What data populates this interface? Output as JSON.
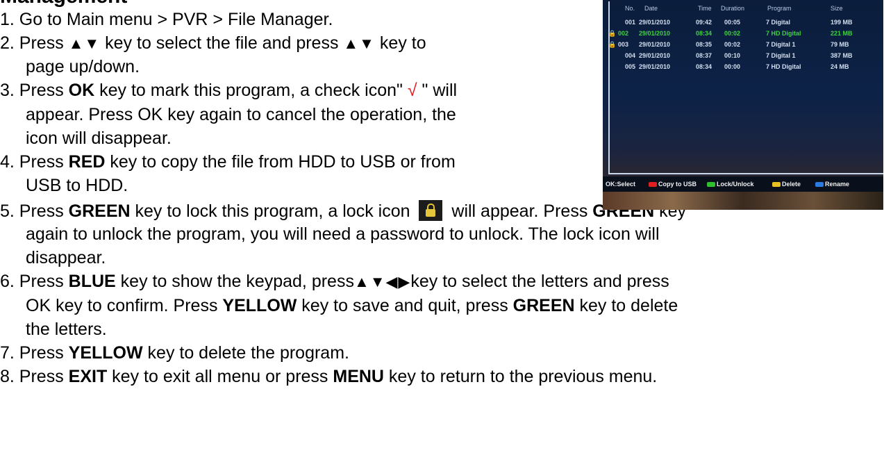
{
  "heading": "Management",
  "steps": {
    "s1": "1. Go to Main menu > PVR > File Manager.",
    "s2a": "2. Press ",
    "s2_sym1": "▲▼",
    "s2b": " key to select the file and press ",
    "s2_sym2": "▲▼",
    "s2c": " key to",
    "s2d": "page up/down.",
    "s3a": "3. Press ",
    "s3_ok": "OK",
    "s3b": " key to mark this program, a check icon\" ",
    "s3_check": "√",
    "s3c": " \" will",
    "s3d": "appear. Press OK key again to cancel the operation, the",
    "s3e": "icon will disappear.",
    "s4a": "4. Press ",
    "s4_red": "RED",
    "s4b": " key to copy the file from HDD to USB or from",
    "s4c": "USB to HDD.",
    "s5a": "5. Press ",
    "s5_green": "GREEN",
    "s5b": " key to lock this program, a lock icon ",
    "s5c": " will appear. Press ",
    "s5_green2": "GREEN",
    "s5d": " key",
    "s5e": "again to unlock the program, you will need a password to unlock. The lock icon will",
    "s5f": "disappear.",
    "s6a": "6. Press ",
    "s6_blue": "BLUE",
    "s6b": " key to show the keypad, press",
    "s6_sym": "▲▼◀▶",
    "s6c": "key to select the letters and press",
    "s6d": "OK key to confirm. Press ",
    "s6_yellow": "YELLOW",
    "s6e": " key to save and quit, press ",
    "s6_green": "GREEN",
    "s6f": " key to delete",
    "s6g": "the letters.",
    "s7a": "7. Press ",
    "s7_yellow": "YELLOW",
    "s7b": " key to delete the program.",
    "s8a": "8. Press ",
    "s8_exit": "EXIT",
    "s8b": " key to exit all menu or press ",
    "s8_menu": "MENU",
    "s8c": " key to return to the previous menu."
  },
  "screen": {
    "headers": {
      "no": "No.",
      "date": "Date",
      "time": "Time",
      "duration": "Duration",
      "program": "Program",
      "size": "Size"
    },
    "rows": [
      {
        "no": "001",
        "date": "29/01/2010",
        "time": "09:42",
        "duration": "00:05",
        "program": "7 Digital",
        "size": "199 MB",
        "mark": ""
      },
      {
        "no": "002",
        "date": "29/01/2010",
        "time": "08:34",
        "duration": "00:02",
        "program": "7 HD Digital",
        "size": "221 MB",
        "mark": "🔒"
      },
      {
        "no": "003",
        "date": "29/01/2010",
        "time": "08:35",
        "duration": "00:02",
        "program": "7 Digital 1",
        "size": "79 MB",
        "mark": "🔒"
      },
      {
        "no": "004",
        "date": "29/01/2010",
        "time": "08:37",
        "duration": "00:10",
        "program": "7 Digital 1",
        "size": "387 MB",
        "mark": ""
      },
      {
        "no": "005",
        "date": "29/01/2010",
        "time": "08:34",
        "duration": "00:00",
        "program": "7 HD Digital",
        "size": "24 MB",
        "mark": ""
      }
    ],
    "footer": {
      "select": "OK:Select",
      "copy": "Copy to USB",
      "lock": "Lock/Unlock",
      "delete": "Delete",
      "rename": "Rename"
    },
    "colors": {
      "red": "#e02020",
      "green": "#2fbf2f",
      "yellow": "#e8c020",
      "blue": "#2a7ae0"
    }
  }
}
